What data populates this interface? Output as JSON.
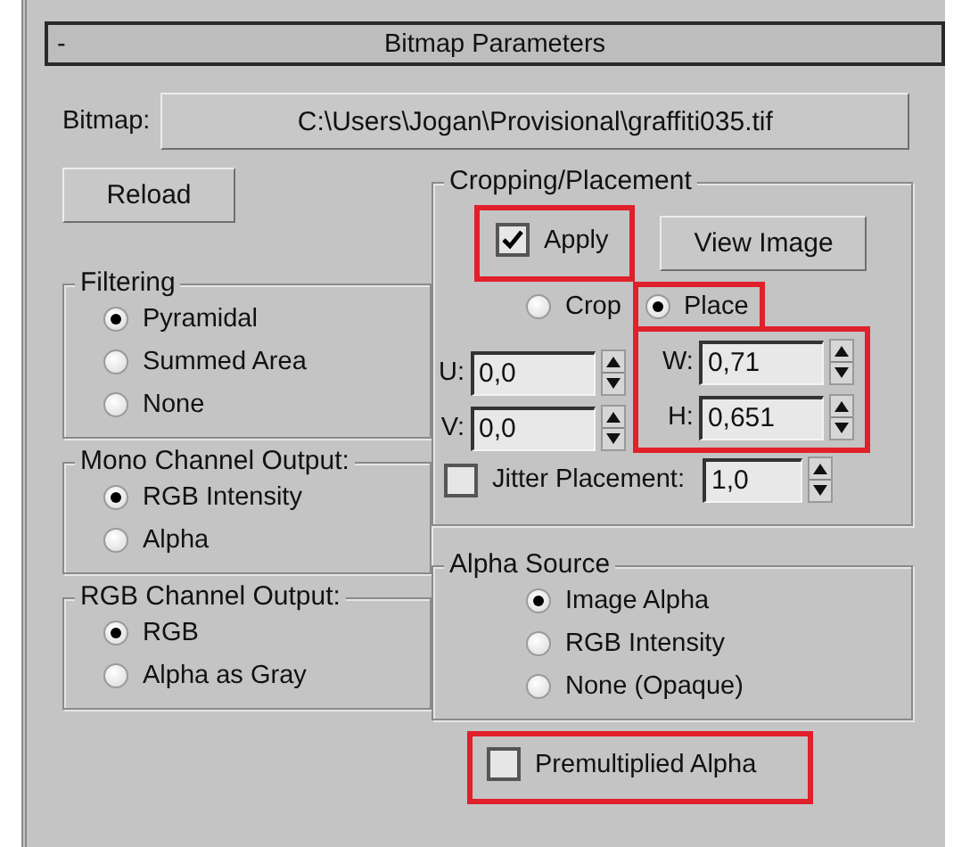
{
  "panel": {
    "collapse_glyph": "-",
    "title": "Bitmap Parameters"
  },
  "bitmap": {
    "label": "Bitmap:",
    "path": "C:\\Users\\Jogan\\Provisional\\graffiti035.tif"
  },
  "reload_button": "Reload",
  "filtering": {
    "title": "Filtering",
    "options": [
      {
        "label": "Pyramidal",
        "selected": true
      },
      {
        "label": "Summed Area",
        "selected": false
      },
      {
        "label": "None",
        "selected": false
      }
    ]
  },
  "mono_channel_output": {
    "title": "Mono Channel Output:",
    "options": [
      {
        "label": "RGB Intensity",
        "selected": true
      },
      {
        "label": "Alpha",
        "selected": false
      }
    ]
  },
  "rgb_channel_output": {
    "title": "RGB Channel Output:",
    "options": [
      {
        "label": "RGB",
        "selected": true
      },
      {
        "label": "Alpha as Gray",
        "selected": false
      }
    ]
  },
  "cropping_placement": {
    "title": "Cropping/Placement",
    "apply": {
      "label": "Apply",
      "checked": true,
      "highlighted": true
    },
    "view_image_button": "View Image",
    "modes": [
      {
        "label": "Crop",
        "selected": false
      },
      {
        "label": "Place",
        "selected": true
      }
    ],
    "offsets": [
      {
        "label": "U:",
        "value": "0,0"
      },
      {
        "label": "V:",
        "value": "0,0"
      }
    ],
    "place_highlighted": true,
    "size": {
      "fields": [
        {
          "label": "W:",
          "value": "0,71"
        },
        {
          "label": "H:",
          "value": "0,651"
        }
      ]
    },
    "jitter": {
      "label": "Jitter Placement:",
      "checked": false,
      "value": "1,0"
    }
  },
  "alpha_source": {
    "title": "Alpha Source",
    "options": [
      {
        "label": "Image Alpha",
        "selected": true
      },
      {
        "label": "RGB Intensity",
        "selected": false
      },
      {
        "label": "None (Opaque)",
        "selected": false
      }
    ]
  },
  "premultiplied_alpha": {
    "label": "Premultiplied Alpha",
    "checked": false,
    "highlighted": true
  }
}
